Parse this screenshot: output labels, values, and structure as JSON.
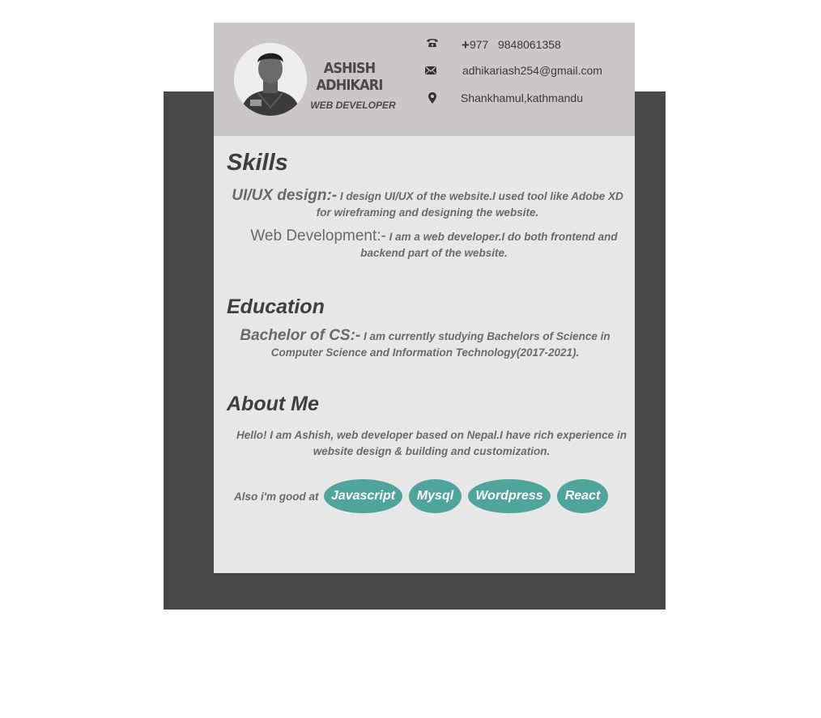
{
  "profile": {
    "first_name": "ASHISH",
    "last_name": "ADHIKARI",
    "title": "WEB DEVELOPER",
    "avatar_icon": "profile-photo"
  },
  "contact": {
    "phone_icon": "phone-icon",
    "phone_prefix": "+",
    "phone_code": "977",
    "phone_number": "9848061358",
    "email_icon": "envelope-icon",
    "email": "adhikariash254@gmail.com",
    "location_icon": "map-pin-icon",
    "location": "Shankhamul,kathmandu"
  },
  "skills": {
    "heading": "Skills",
    "items": [
      {
        "label": "UI/UX design:-",
        "description": "I design UI/UX of the website.I used tool like Adobe XD for wireframing and designing the website."
      },
      {
        "label": "Web Development:-",
        "description": "I am a web developer.I do both frontend and backend part of the website."
      }
    ]
  },
  "education": {
    "heading": "Education",
    "items": [
      {
        "label": "Bachelor of CS:-",
        "description": "I am currently studying Bachelors of Science in Computer Science and Information Technology(2017-2021)."
      }
    ]
  },
  "about": {
    "heading": "About Me",
    "text": "Hello! I am Ashish, web developer based on Nepal.I have rich experience in website design & building and customization.",
    "good_at_label": "Also i'm good at",
    "tags": [
      "Javascript",
      "Mysql",
      "Wordpress",
      "React"
    ]
  },
  "colors": {
    "backdrop": "#474747",
    "card": "#e7e7e7",
    "header": "#c9c7c8",
    "accent": "#4fa49c"
  }
}
